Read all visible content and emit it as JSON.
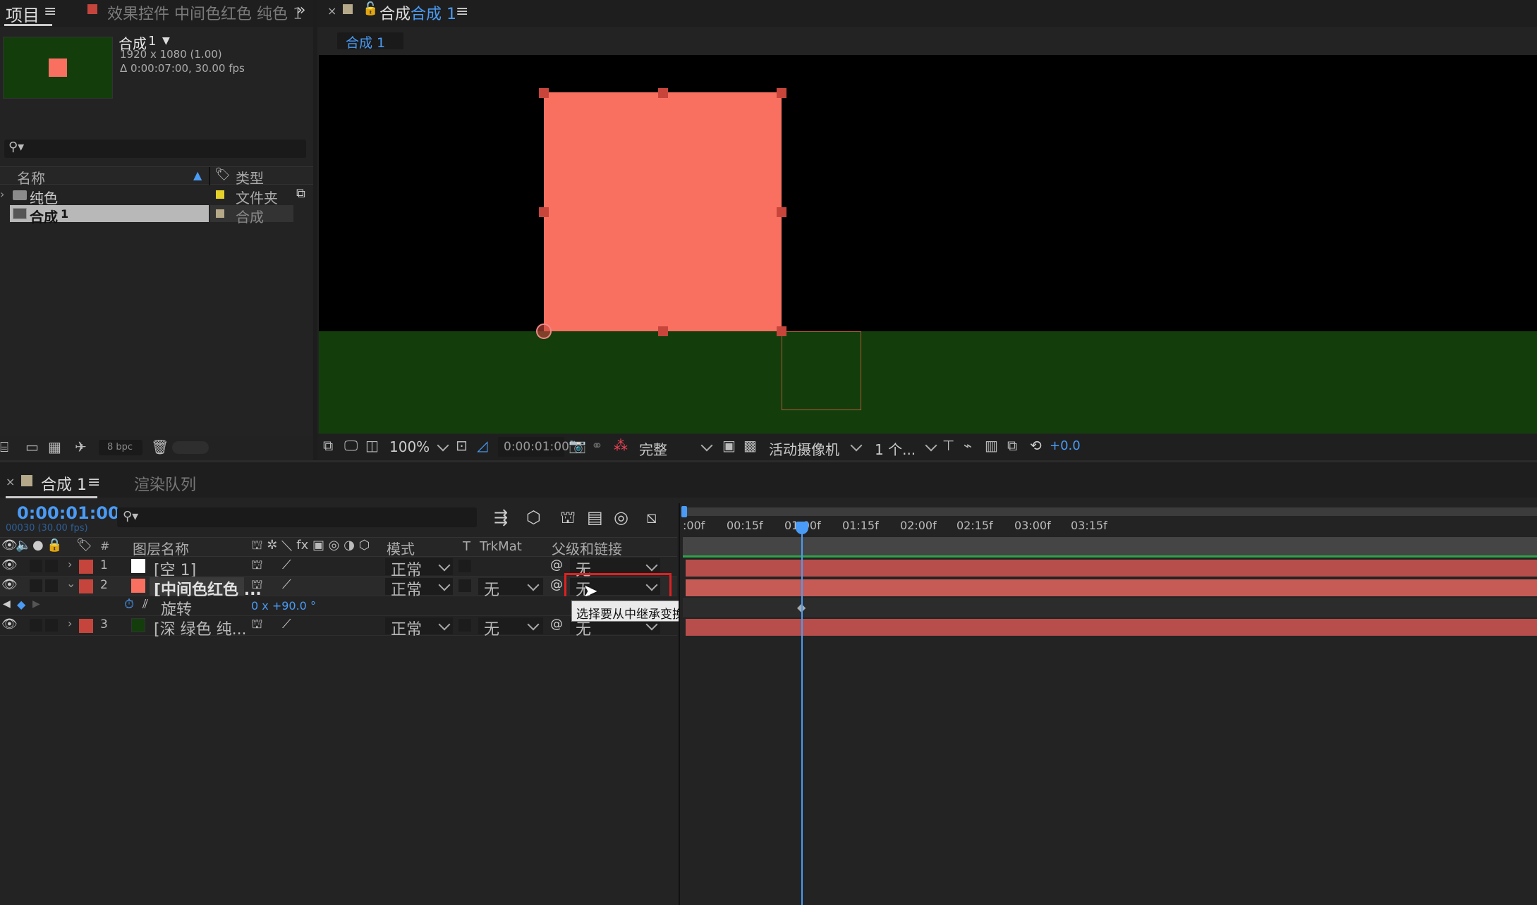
{
  "project_panel": {
    "tab_title": "项目",
    "effects_tab": "效果控件 中间色红色 纯色 1",
    "comp_name": "合成",
    "comp_num": "1",
    "comp_size": "1920 x 1080 (1.00)",
    "comp_duration": "Δ 0:00:07:00, 30.00 fps",
    "col_name": "名称",
    "col_type": "类型",
    "items": [
      {
        "name": "纯色",
        "type": "文件夹"
      },
      {
        "name": "合成",
        "num": "1",
        "type": "合成"
      }
    ],
    "bpc": "8 bpc"
  },
  "viewer": {
    "tab_prefix": "合成",
    "tab_comp": "合成 1",
    "breadcrumb": "合成 1",
    "zoom": "100%",
    "timecode": "0:00:01:00",
    "resolution": "完整",
    "camera": "活动摄像机",
    "views": "1 个...",
    "exposure": "+0.0"
  },
  "timeline": {
    "tab_title": "合成 1",
    "render_queue": "渲染队列",
    "current_time": "0:00:01:00",
    "frame_info": "00030 (30.00 fps)",
    "col_layer_name": "图层名称",
    "col_mode": "模式",
    "col_t": "T",
    "col_trkmat": "TrkMat",
    "col_parent": "父级和链接",
    "ruler": [
      ":00f",
      "00:15f",
      "01:00f",
      "01:15f",
      "02:00f",
      "02:15f",
      "03:00f",
      "03:15f"
    ],
    "layers": [
      {
        "num": "1",
        "name": "[空 1]",
        "mode": "正常",
        "trkmat": "",
        "parent": "无"
      },
      {
        "num": "2",
        "name": "[中间色红色 ...",
        "mode": "正常",
        "trkmat": "无",
        "parent": "无"
      },
      {
        "num": "3",
        "name": "[深 绿色 纯...",
        "mode": "正常",
        "trkmat": "无",
        "parent": "无"
      }
    ],
    "rotation_label": "旋转",
    "rotation_value": "0 x +90.0 °",
    "tooltip": "选择要从中继承变换的图层"
  },
  "colors": {
    "accent": "#4a9bf5",
    "salmon": "#fa7060",
    "dark_green": "#133e0c",
    "label_red": "#c5453c",
    "highlight_box": "#e02020"
  }
}
